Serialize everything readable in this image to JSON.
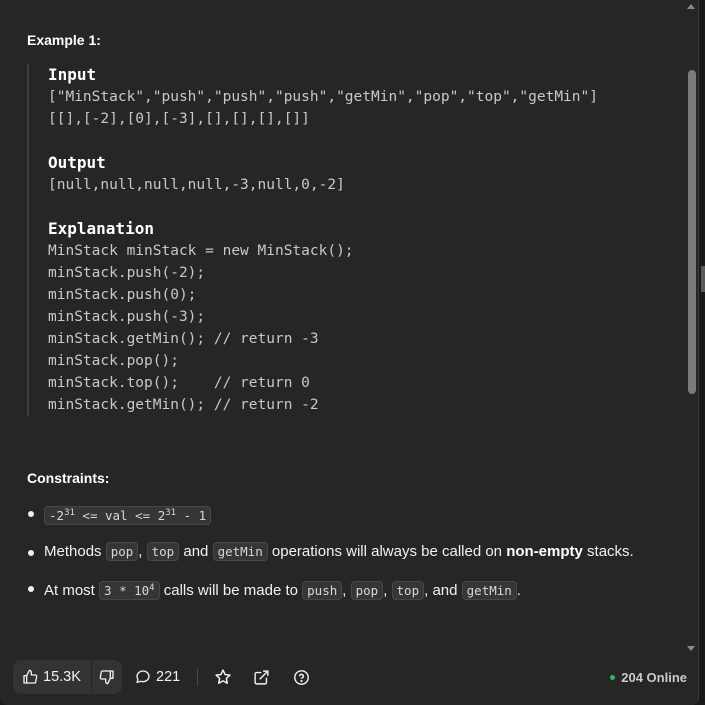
{
  "example": {
    "title": "Example 1:",
    "input_label": "Input",
    "input_lines": [
      "[\"MinStack\",\"push\",\"push\",\"push\",\"getMin\",\"pop\",\"top\",\"getMin\"]",
      "[[],[-2],[0],[-3],[],[],[],[]]"
    ],
    "output_label": "Output",
    "output_lines": [
      "[null,null,null,null,-3,null,0,-2]"
    ],
    "explanation_label": "Explanation",
    "explanation_lines": [
      "MinStack minStack = new MinStack();",
      "minStack.push(-2);",
      "minStack.push(0);",
      "minStack.push(-3);",
      "minStack.getMin(); // return -3",
      "minStack.pop();",
      "minStack.top();    // return 0",
      "minStack.getMin(); // return -2"
    ]
  },
  "constraints": {
    "title": "Constraints:",
    "c1": {
      "lhs_base": "-2",
      "exp1": "31",
      "mid": " <= val <= 2",
      "exp2": "31",
      "rhs": " - 1"
    },
    "c2": {
      "text1": "Methods ",
      "code1": "pop",
      "text2": ", ",
      "code2": "top",
      "text3": " and ",
      "code3": "getMin",
      "text4": " operations will always be called on ",
      "bold": "non-empty",
      "text5": " stacks."
    },
    "c3": {
      "text1": "At most ",
      "code_base": "3 * 10",
      "code_exp": "4",
      "text2": " calls will be made to ",
      "code1": "push",
      "sep1": ", ",
      "code2": "pop",
      "sep2": ", ",
      "code3": "top",
      "sep3": ", and ",
      "code4": "getMin",
      "end": "."
    }
  },
  "toolbar": {
    "likes": "15.3K",
    "comments": "221",
    "online": "204 Online",
    "icons": [
      "thumbs-up-icon",
      "thumbs-down-icon",
      "comment-icon",
      "star-icon",
      "share-icon",
      "help-icon"
    ]
  },
  "colors": {
    "background": "#262626",
    "text": "#eff1f6",
    "online_dot": "#2cbb5d"
  }
}
